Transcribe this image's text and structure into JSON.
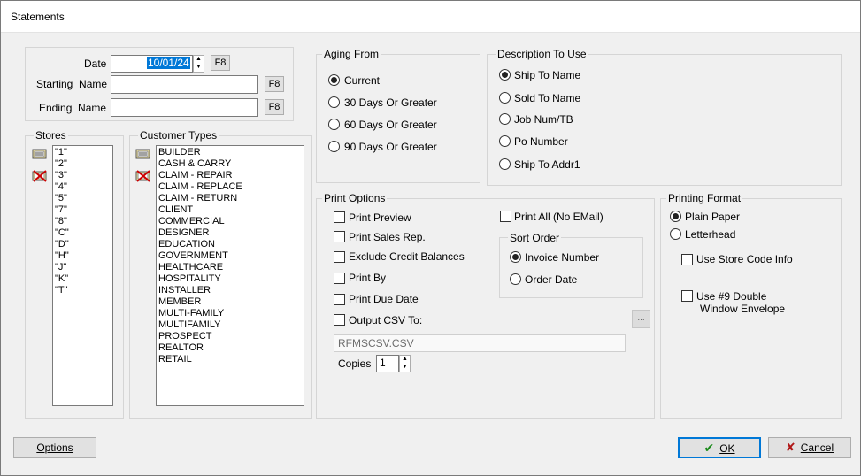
{
  "window": {
    "title": "Statements"
  },
  "date_group": {
    "date_label": "Date",
    "date_value": "10/01/24",
    "date_f8": "F8",
    "starting_label": "Starting  Name",
    "starting_value": "",
    "starting_f8": "F8",
    "ending_label": "Ending  Name",
    "ending_value": "",
    "ending_f8": "F8"
  },
  "stores": {
    "title": "Stores",
    "items": [
      "\"1\"",
      "\"2\"",
      "\"3\"",
      "\"4\"",
      "\"5\"",
      "\"7\"",
      "\"8\"",
      "\"C\"",
      "\"D\"",
      "\"H\"",
      "\"J\"",
      "\"K\"",
      "\"T\""
    ]
  },
  "customer_types": {
    "title": "Customer Types",
    "items": [
      "BUILDER",
      "CASH & CARRY",
      "CLAIM - REPAIR",
      "CLAIM - REPLACE",
      "CLAIM - RETURN",
      "CLIENT",
      "COMMERCIAL",
      "DESIGNER",
      "EDUCATION",
      "GOVERNMENT",
      "HEALTHCARE",
      "HOSPITALITY",
      "INSTALLER",
      "MEMBER",
      "MULTI-FAMILY",
      "MULTIFAMILY",
      "PROSPECT",
      "REALTOR",
      "RETAIL"
    ]
  },
  "aging": {
    "title": "Aging From",
    "options": [
      "Current",
      "30 Days Or Greater",
      "60 Days Or Greater",
      "90 Days Or Greater"
    ],
    "selected": "Current"
  },
  "description": {
    "title": "Description To Use",
    "options": [
      "Ship To Name",
      "Sold To Name",
      "Job Num/TB",
      "Po Number",
      "Ship To Addr1"
    ],
    "selected": "Ship To Name"
  },
  "print_options": {
    "title": "Print Options",
    "print_preview": "Print Preview",
    "print_sales_rep": "Print Sales Rep.",
    "exclude_credit": "Exclude Credit Balances",
    "print_by": "Print By",
    "print_due_date": "Print Due Date",
    "output_csv": "Output CSV To:",
    "csv_path": "RFMSCSV.CSV",
    "browse": "...",
    "copies_label": "Copies",
    "copies_value": "1",
    "print_all": "Print All (No EMail)",
    "sort_order": {
      "title": "Sort Order",
      "options": [
        "Invoice Number",
        "Order Date"
      ],
      "selected": "Invoice Number"
    }
  },
  "printing_format": {
    "title": "Printing Format",
    "options": [
      "Plain Paper",
      "Letterhead"
    ],
    "selected": "Plain Paper",
    "use_store_code": "Use Store Code Info",
    "use_9_double_line1": "Use #9 Double",
    "use_9_double_line2": "Window Envelope"
  },
  "footer": {
    "options": "Options",
    "ok": "OK",
    "cancel": "Cancel"
  }
}
